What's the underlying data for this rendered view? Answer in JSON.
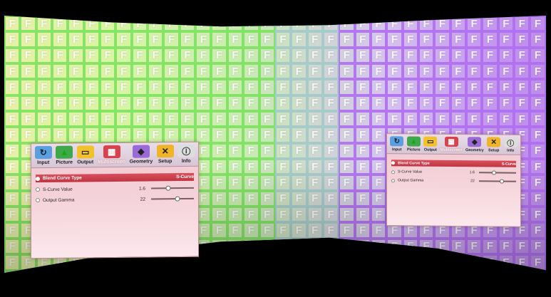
{
  "projection": {
    "grid_letter": "F",
    "colors": {
      "green": "#7ee05f",
      "purple": "#af6ef0",
      "backdrop": "#000000"
    }
  },
  "osd_left": {
    "tabs": [
      {
        "label": "Input",
        "icon": "input-icon",
        "glyph": "↻",
        "bg": "#5aa0e0",
        "fg": "#123"
      },
      {
        "label": "Picture",
        "icon": "picture-icon",
        "glyph": "▲",
        "bg": "#3ea84a",
        "fg": "#1a1"
      },
      {
        "label": "Output",
        "icon": "output-icon",
        "glyph": "▭",
        "bg": "#f1c12e",
        "fg": "#222"
      },
      {
        "label": "Multiscreen",
        "icon": "multiscreen-icon",
        "glyph": "▦",
        "bg": "#d8424b",
        "fg": "#fff",
        "active": true
      },
      {
        "label": "Geometry",
        "icon": "geometry-icon",
        "glyph": "◆",
        "bg": "#9a6ad6",
        "fg": "#222"
      },
      {
        "label": "Setup",
        "icon": "setup-icon",
        "glyph": "✕",
        "bg": "#f0b429",
        "fg": "#222"
      },
      {
        "label": "Info",
        "icon": "info-icon",
        "glyph": "ⓘ",
        "bg": "#dddddd",
        "fg": "#222"
      }
    ],
    "header": {
      "label": "Blend Curve Type",
      "value": "S-Curve"
    },
    "rows": [
      {
        "label": "S-Curve Value",
        "value": "1.6",
        "level": 0.4
      },
      {
        "label": "Output Gamma",
        "value": "22",
        "level": 0.62
      }
    ]
  },
  "osd_right": {
    "tabs": [
      {
        "label": "Input",
        "icon": "input-icon",
        "glyph": "↻",
        "bg": "#5aa0e0",
        "fg": "#123"
      },
      {
        "label": "Picture",
        "icon": "picture-icon",
        "glyph": "▲",
        "bg": "#3ea84a",
        "fg": "#1a1"
      },
      {
        "label": "Output",
        "icon": "output-icon",
        "glyph": "▭",
        "bg": "#f1c12e",
        "fg": "#222"
      },
      {
        "label": "Multiscreen",
        "icon": "multiscreen-icon",
        "glyph": "▦",
        "bg": "#d8424b",
        "fg": "#fff",
        "active": true
      },
      {
        "label": "Geometry",
        "icon": "geometry-icon",
        "glyph": "◆",
        "bg": "#9a6ad6",
        "fg": "#222"
      },
      {
        "label": "Setup",
        "icon": "setup-icon",
        "glyph": "✕",
        "bg": "#f0b429",
        "fg": "#222"
      },
      {
        "label": "Info",
        "icon": "info-icon",
        "glyph": "ⓘ",
        "bg": "#dddddd",
        "fg": "#222"
      }
    ],
    "header": {
      "label": "Blend Curve Type",
      "value": "S-Curve"
    },
    "rows": [
      {
        "label": "S-Curve Value",
        "value": "1.6",
        "level": 0.4
      },
      {
        "label": "Output Gamma",
        "value": "22",
        "level": 0.62
      }
    ]
  }
}
